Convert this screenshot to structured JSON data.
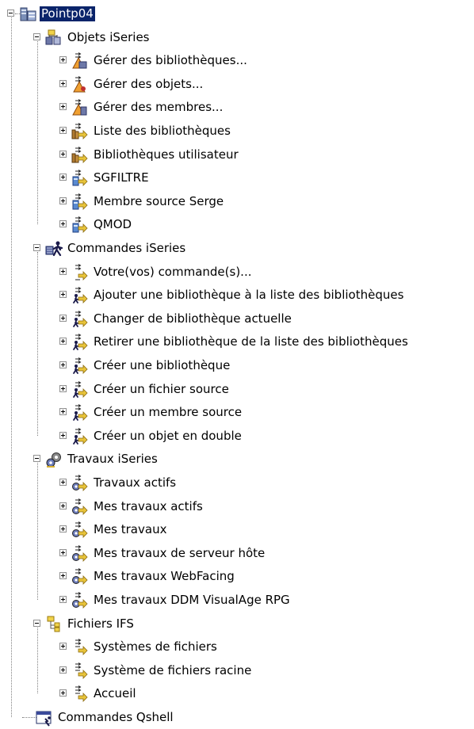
{
  "tree": {
    "root": {
      "label": "Pointp04",
      "icon": "system-connection-icon",
      "expanded": true,
      "selected": true
    },
    "groups": [
      {
        "label": "Objets iSeries",
        "icon": "objects-folder-icon",
        "expanded": true,
        "items": [
          {
            "label": "Gérer des bibliothèques...",
            "icon": "manage-libraries-icon"
          },
          {
            "label": "Gérer des objets...",
            "icon": "manage-objects-icon"
          },
          {
            "label": "Gérer des membres...",
            "icon": "manage-members-icon"
          },
          {
            "label": "Liste des bibliothèques",
            "icon": "library-list-filter-icon"
          },
          {
            "label": "Bibliothèques utilisateur",
            "icon": "user-libraries-filter-icon"
          },
          {
            "label": "SGFILTRE",
            "icon": "object-filter-icon"
          },
          {
            "label": "Membre source Serge",
            "icon": "object-filter-icon"
          },
          {
            "label": "QMOD",
            "icon": "object-filter-icon"
          }
        ]
      },
      {
        "label": "Commandes iSeries",
        "icon": "commands-runner-icon",
        "expanded": true,
        "items": [
          {
            "label": "Votre(vos) commande(s)...",
            "icon": "new-command-filter-icon"
          },
          {
            "label": "Ajouter une bibliothèque à la liste des bibliothèques",
            "icon": "command-filter-icon"
          },
          {
            "label": "Changer de bibliothèque actuelle",
            "icon": "command-filter-icon"
          },
          {
            "label": "Retirer une bibliothèque de la liste des bibliothèques",
            "icon": "command-filter-icon"
          },
          {
            "label": "Créer une bibliothèque",
            "icon": "command-filter-icon"
          },
          {
            "label": "Créer un fichier source",
            "icon": "command-filter-icon"
          },
          {
            "label": "Créer un membre source",
            "icon": "command-filter-icon"
          },
          {
            "label": "Créer un objet en double",
            "icon": "command-filter-icon"
          }
        ]
      },
      {
        "label": "Travaux iSeries",
        "icon": "jobs-gears-icon",
        "expanded": true,
        "items": [
          {
            "label": "Travaux actifs",
            "icon": "job-filter-icon"
          },
          {
            "label": "Mes travaux actifs",
            "icon": "job-filter-icon"
          },
          {
            "label": "Mes travaux",
            "icon": "job-filter-icon"
          },
          {
            "label": "Mes travaux de serveur hôte",
            "icon": "job-filter-icon"
          },
          {
            "label": "Mes travaux WebFacing",
            "icon": "job-filter-icon"
          },
          {
            "label": "Mes travaux DDM VisualAge RPG",
            "icon": "job-filter-icon"
          }
        ]
      },
      {
        "label": "Fichiers IFS",
        "icon": "ifs-files-icon",
        "expanded": true,
        "items": [
          {
            "label": "Systèmes de fichiers",
            "icon": "file-filter-icon"
          },
          {
            "label": "Système de fichiers racine",
            "icon": "file-filter-icon"
          },
          {
            "label": "Accueil",
            "icon": "file-filter-icon"
          }
        ]
      },
      {
        "label": "Commandes Qshell",
        "icon": "qshell-window-icon",
        "leaf": true,
        "items": []
      }
    ]
  },
  "colors": {
    "selection": "#0a246a",
    "tree_line": "#808080",
    "filter_arrow": "#e8c43a",
    "folder_yellow": "#f0d24a"
  }
}
